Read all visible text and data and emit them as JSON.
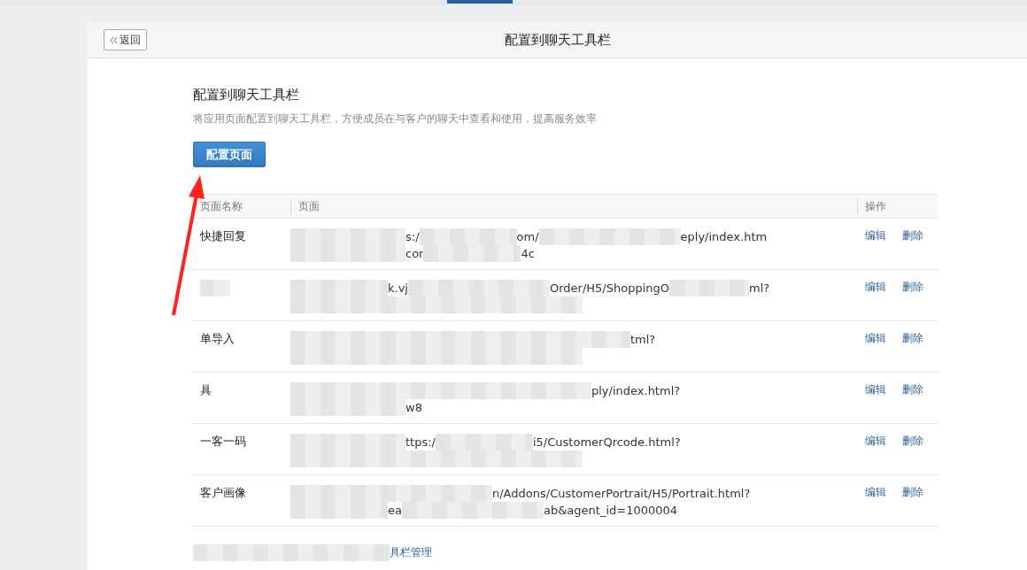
{
  "header": {
    "back": "返回",
    "title": "配置到聊天工具栏"
  },
  "section": {
    "title": "配置到聊天工具栏",
    "description": "将应用页面配置到聊天工具栏，方便成员在与客户的聊天中查看和使用，提高服务效率",
    "button": "配置页面"
  },
  "table": {
    "columns": [
      "页面名称",
      "页面",
      "操作"
    ],
    "rows": [
      {
        "name": "快捷回复",
        "url_lines": [
          [
            "s:/",
            "om/",
            "eply/index.htm"
          ],
          [
            "cor",
            "4c"
          ]
        ],
        "actions": [
          "编辑",
          "删除"
        ]
      },
      {
        "url_lines": [
          [
            "k.vj",
            "Order/H5/ShoppingO",
            "ml?"
          ]
        ],
        "actions": [
          "编辑",
          "删除"
        ]
      },
      {
        "name": "单导入",
        "url_lines": [
          [
            "tml?"
          ]
        ],
        "actions": [
          "编辑",
          "删除"
        ]
      },
      {
        "name": "具",
        "url_lines": [
          [
            "ply/index.html?"
          ],
          [
            "w8"
          ]
        ],
        "actions": [
          "编辑",
          "删除"
        ]
      },
      {
        "name": "一客一码",
        "url_lines": [
          [
            "ttps:/",
            "i5/CustomerQrcode.html?"
          ]
        ],
        "actions": [
          "编辑",
          "删除"
        ]
      },
      {
        "name": "客户画像",
        "url_lines": [
          [
            "n/Addons/CustomerPortrait/H5/Portrait.html?"
          ],
          [
            "ea",
            "ab&agent_id=1000004"
          ]
        ],
        "actions": [
          "编辑",
          "删除"
        ]
      }
    ]
  },
  "footer_link": "具栏管理"
}
